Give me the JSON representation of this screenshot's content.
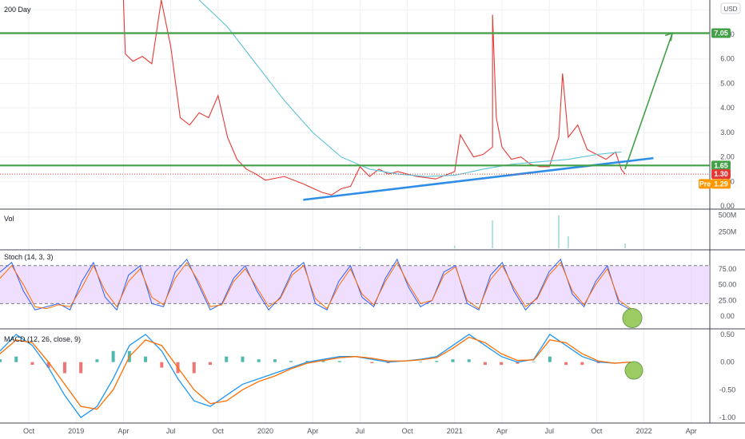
{
  "colors": {
    "background": "#ffffff",
    "grid": "#eef0f3",
    "price_line": "#e53935",
    "ma": "#5cc2d6",
    "green": "#43a047",
    "trend_blue": "#2e8de6",
    "stoch_band": "#e6c8ff",
    "stoch_k": "#2962ff",
    "stoch_d": "#ff6d00",
    "macd": "#2196f3",
    "signal": "#ff6d00",
    "hist_up": "#26a69a",
    "hist_down": "#ef5350",
    "volume": "#b2dfdb",
    "current_tag": "#e53935",
    "premarket_tag": "#ff9800",
    "circle": "#8bc34a"
  },
  "header": {
    "indicator_label": "200 Day",
    "currency_button": "USD"
  },
  "chart_data": [
    {
      "type": "line",
      "pane": "price",
      "y_axis": {
        "range": [
          0,
          8.4
        ],
        "ticks": [
          "8.00",
          "7.00",
          "6.00",
          "5.00",
          "4.00",
          "3.00",
          "2.00",
          "1.00",
          "0.00"
        ]
      },
      "x_axis": {
        "ticks": [
          "Oct",
          "2019",
          "Apr",
          "Jul",
          "Oct",
          "2020",
          "Apr",
          "Jul",
          "Oct",
          "2021",
          "Apr",
          "Jul",
          "Oct",
          "2022",
          "Apr"
        ]
      },
      "series": [
        {
          "role": "price",
          "points": [
            [
              2019.25,
              8.4
            ],
            [
              2019.26,
              6.2
            ],
            [
              2019.3,
              5.9
            ],
            [
              2019.35,
              6.1
            ],
            [
              2019.4,
              5.8
            ],
            [
              2019.45,
              8.4
            ],
            [
              2019.5,
              6.5
            ],
            [
              2019.55,
              3.6
            ],
            [
              2019.6,
              3.3
            ],
            [
              2019.65,
              3.8
            ],
            [
              2019.7,
              3.6
            ],
            [
              2019.75,
              4.5
            ],
            [
              2019.8,
              2.8
            ],
            [
              2019.85,
              1.9
            ],
            [
              2019.9,
              1.5
            ],
            [
              2019.95,
              1.3
            ],
            [
              2020.0,
              1.05
            ],
            [
              2020.1,
              1.2
            ],
            [
              2020.2,
              0.9
            ],
            [
              2020.3,
              0.55
            ],
            [
              2020.35,
              0.45
            ],
            [
              2020.4,
              0.7
            ],
            [
              2020.45,
              0.8
            ],
            [
              2020.5,
              1.6
            ],
            [
              2020.55,
              1.2
            ],
            [
              2020.6,
              1.5
            ],
            [
              2020.65,
              1.3
            ],
            [
              2020.7,
              1.4
            ],
            [
              2020.8,
              1.2
            ],
            [
              2020.9,
              1.1
            ],
            [
              2021.0,
              1.4
            ],
            [
              2021.03,
              2.9
            ],
            [
              2021.06,
              2.5
            ],
            [
              2021.1,
              2.0
            ],
            [
              2021.15,
              2.1
            ],
            [
              2021.2,
              2.4
            ],
            [
              2021.2,
              7.8
            ],
            [
              2021.22,
              3.6
            ],
            [
              2021.25,
              2.4
            ],
            [
              2021.3,
              1.9
            ],
            [
              2021.35,
              2.0
            ],
            [
              2021.4,
              1.7
            ],
            [
              2021.45,
              1.6
            ],
            [
              2021.5,
              1.6
            ],
            [
              2021.55,
              2.8
            ],
            [
              2021.57,
              5.4
            ],
            [
              2021.6,
              2.8
            ],
            [
              2021.65,
              3.3
            ],
            [
              2021.7,
              2.3
            ],
            [
              2021.75,
              2.1
            ],
            [
              2021.8,
              1.9
            ],
            [
              2021.85,
              2.2
            ],
            [
              2021.88,
              1.5
            ],
            [
              2021.9,
              1.3
            ]
          ]
        },
        {
          "name": "200 Day",
          "role": "moving_average",
          "points": [
            [
              2019.65,
              8.4
            ],
            [
              2019.8,
              7.3
            ],
            [
              2019.95,
              5.8
            ],
            [
              2020.1,
              4.3
            ],
            [
              2020.25,
              3.0
            ],
            [
              2020.4,
              2.0
            ],
            [
              2020.55,
              1.5
            ],
            [
              2020.7,
              1.3
            ],
            [
              2020.85,
              1.2
            ],
            [
              2021.0,
              1.25
            ],
            [
              2021.15,
              1.5
            ],
            [
              2021.3,
              1.7
            ],
            [
              2021.45,
              1.8
            ],
            [
              2021.6,
              1.9
            ],
            [
              2021.75,
              2.1
            ],
            [
              2021.88,
              2.2
            ]
          ]
        },
        {
          "role": "projection",
          "points": [
            [
              2021.9,
              1.5
            ],
            [
              2022.15,
              7.05
            ]
          ]
        },
        {
          "role": "trendline",
          "points": [
            [
              2020.2,
              0.25
            ],
            [
              2022.05,
              1.95
            ]
          ]
        }
      ],
      "horizontal_levels": [
        {
          "value": 7.05,
          "label": "7.05"
        },
        {
          "value": 1.65,
          "label": "1.65"
        }
      ],
      "price_tags": [
        {
          "value": 1.3,
          "label": "1.30",
          "kind": "current"
        },
        {
          "value": 1.29,
          "label": "1.29",
          "prefix": "Pre",
          "kind": "premarket"
        }
      ]
    },
    {
      "type": "bar",
      "pane": "volume",
      "title": "Vol",
      "y_axis": {
        "ticks": [
          "500M",
          "250M"
        ]
      },
      "spikes": [
        [
          2020.5,
          20
        ],
        [
          2021.0,
          40
        ],
        [
          2021.2,
          420
        ],
        [
          2021.55,
          500
        ],
        [
          2021.6,
          180
        ],
        [
          2021.9,
          70
        ]
      ]
    },
    {
      "type": "line",
      "pane": "stoch",
      "title": "Stoch (14, 3, 3)",
      "y_axis": {
        "range": [
          -20,
          105
        ],
        "ticks": [
          "75.00",
          "50.00",
          "25.00",
          "0.00"
        ]
      },
      "band": [
        20,
        80
      ],
      "k_values": [
        70,
        85,
        40,
        10,
        15,
        20,
        10,
        55,
        85,
        30,
        10,
        65,
        80,
        20,
        15,
        70,
        90,
        50,
        10,
        20,
        60,
        80,
        40,
        10,
        30,
        70,
        85,
        20,
        10,
        55,
        80,
        30,
        15,
        60,
        90,
        45,
        15,
        25,
        70,
        80,
        20,
        10,
        65,
        85,
        40,
        10,
        30,
        70,
        90,
        35,
        15,
        55,
        80,
        20,
        10
      ],
      "d_values": [
        60,
        80,
        50,
        15,
        12,
        18,
        15,
        45,
        80,
        40,
        15,
        55,
        75,
        30,
        18,
        60,
        85,
        55,
        15,
        18,
        55,
        75,
        45,
        15,
        28,
        65,
        80,
        28,
        12,
        48,
        75,
        35,
        18,
        55,
        85,
        50,
        20,
        25,
        65,
        78,
        25,
        12,
        58,
        80,
        45,
        15,
        28,
        65,
        85,
        40,
        18,
        50,
        75,
        25,
        12
      ]
    },
    {
      "type": "line",
      "pane": "macd",
      "title": "MACD (12, 26, close, 9)",
      "y_axis": {
        "range": [
          -1.1,
          0.6
        ],
        "ticks": [
          "0.50",
          "0.00",
          "-0.50",
          "-1.00"
        ]
      },
      "macd": [
        0.2,
        0.5,
        0.3,
        -0.1,
        -0.6,
        -1.0,
        -0.8,
        -0.3,
        0.3,
        0.5,
        0.2,
        -0.3,
        -0.7,
        -0.8,
        -0.6,
        -0.4,
        -0.3,
        -0.2,
        -0.1,
        0.0,
        0.05,
        0.1,
        0.1,
        0.05,
        0.0,
        0.02,
        0.05,
        0.1,
        0.3,
        0.5,
        0.3,
        0.1,
        0.0,
        0.05,
        0.5,
        0.3,
        0.1,
        0.0,
        -0.02,
        0.0
      ],
      "signal": [
        0.15,
        0.4,
        0.35,
        0.0,
        -0.4,
        -0.8,
        -0.85,
        -0.5,
        0.1,
        0.4,
        0.3,
        -0.1,
        -0.5,
        -0.75,
        -0.7,
        -0.5,
        -0.35,
        -0.25,
        -0.12,
        -0.02,
        0.03,
        0.08,
        0.1,
        0.07,
        0.02,
        0.02,
        0.04,
        0.08,
        0.25,
        0.45,
        0.35,
        0.15,
        0.03,
        0.04,
        0.4,
        0.35,
        0.15,
        0.02,
        -0.02,
        0.0
      ],
      "histogram": [
        0.05,
        0.1,
        -0.05,
        -0.1,
        -0.2,
        -0.2,
        0.05,
        0.2,
        0.2,
        0.1,
        -0.1,
        -0.2,
        -0.2,
        -0.05,
        0.1,
        0.1,
        0.05,
        0.05,
        0.02,
        0.02,
        0.02,
        0.02,
        0.0,
        -0.02,
        -0.02,
        0.0,
        0.01,
        0.02,
        0.05,
        0.05,
        -0.05,
        -0.05,
        -0.03,
        0.01,
        0.1,
        -0.05,
        -0.05,
        -0.02,
        0.0,
        0.0
      ]
    }
  ]
}
